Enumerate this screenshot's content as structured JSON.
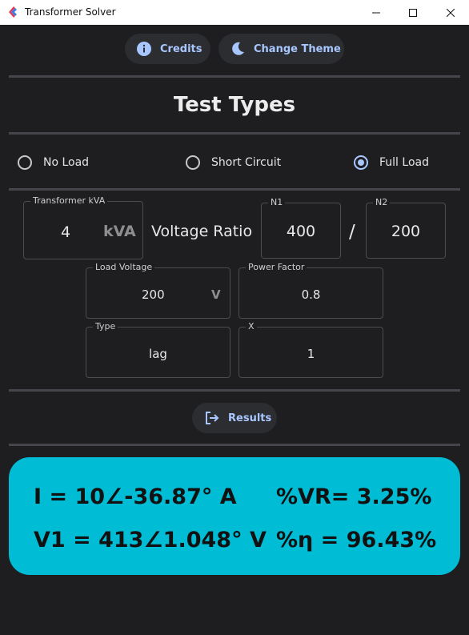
{
  "window": {
    "title": "Transformer Solver"
  },
  "topbar": {
    "credits_label": "Credits",
    "theme_label": "Change Theme"
  },
  "heading": "Test Types",
  "test_types": [
    {
      "label": "No Load",
      "selected": false
    },
    {
      "label": "Short Circuit",
      "selected": false
    },
    {
      "label": "Full Load",
      "selected": true
    }
  ],
  "inputs": {
    "kva": {
      "label": "Transformer kVA",
      "value": "4",
      "unit": "kVA"
    },
    "ratio_label": "Voltage Ratio",
    "n1": {
      "label": "N1",
      "value": "400"
    },
    "ratio_sep": "/",
    "n2": {
      "label": "N2",
      "value": "200"
    },
    "load_voltage": {
      "label": "Load Voltage",
      "value": "200",
      "unit": "V"
    },
    "power_factor": {
      "label": "Power Factor",
      "value": "0.8"
    },
    "type": {
      "label": "Type",
      "value": "lag"
    },
    "x": {
      "label": "X",
      "value": "1"
    }
  },
  "results_button": "Results",
  "results": {
    "current": "I = 10∠-36.87° A",
    "vr": "%VR= 3.25%",
    "v1": "V1 = 413∠1.048° V",
    "eff": "%η = 96.43%"
  },
  "colors": {
    "background": "#1e1e21",
    "accent": "#a9c7ff",
    "result_bg": "#00bcd4"
  }
}
